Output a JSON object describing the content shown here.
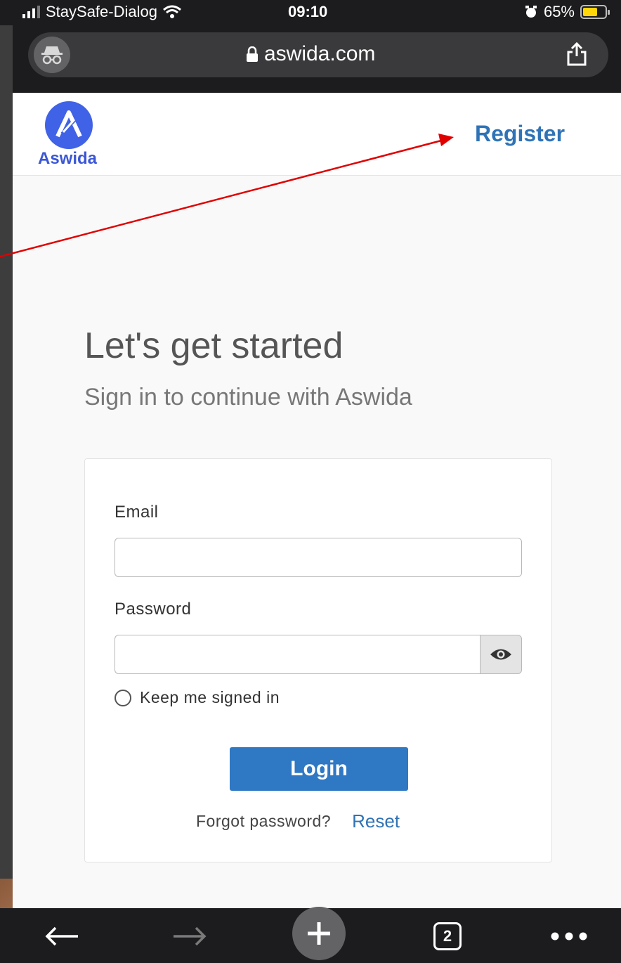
{
  "status_bar": {
    "carrier": "StaySafe-Dialog",
    "time": "09:10",
    "battery_percent": "65%",
    "battery_level": 0.65,
    "icons": [
      "signal-icon",
      "wifi-icon",
      "alarm-icon",
      "battery-icon"
    ]
  },
  "browser": {
    "url": "aswida.com",
    "icons": [
      "incognito-icon",
      "lock-icon",
      "share-icon"
    ],
    "toolbar": {
      "tab_count": "2",
      "icons": [
        "back-arrow-icon",
        "forward-arrow-icon",
        "new-tab-plus-icon",
        "tabs-icon",
        "more-icon"
      ]
    }
  },
  "site": {
    "logo_text": "Aswida",
    "register_label": "Register",
    "brand_color": "#4062e6",
    "link_color": "#2f73b6"
  },
  "hero": {
    "title": "Let's get started",
    "subtitle": "Sign in to continue with Aswida"
  },
  "form": {
    "email_label": "Email",
    "email_value": "",
    "password_label": "Password",
    "password_value": "",
    "keep_signed_in_label": "Keep me signed in",
    "keep_signed_in_checked": false,
    "login_label": "Login",
    "login_color": "#2f78c4",
    "forgot_label": "Forgot password?",
    "reset_label": "Reset"
  },
  "annotation": {
    "color": "#e00000",
    "points_to": "register-link"
  }
}
